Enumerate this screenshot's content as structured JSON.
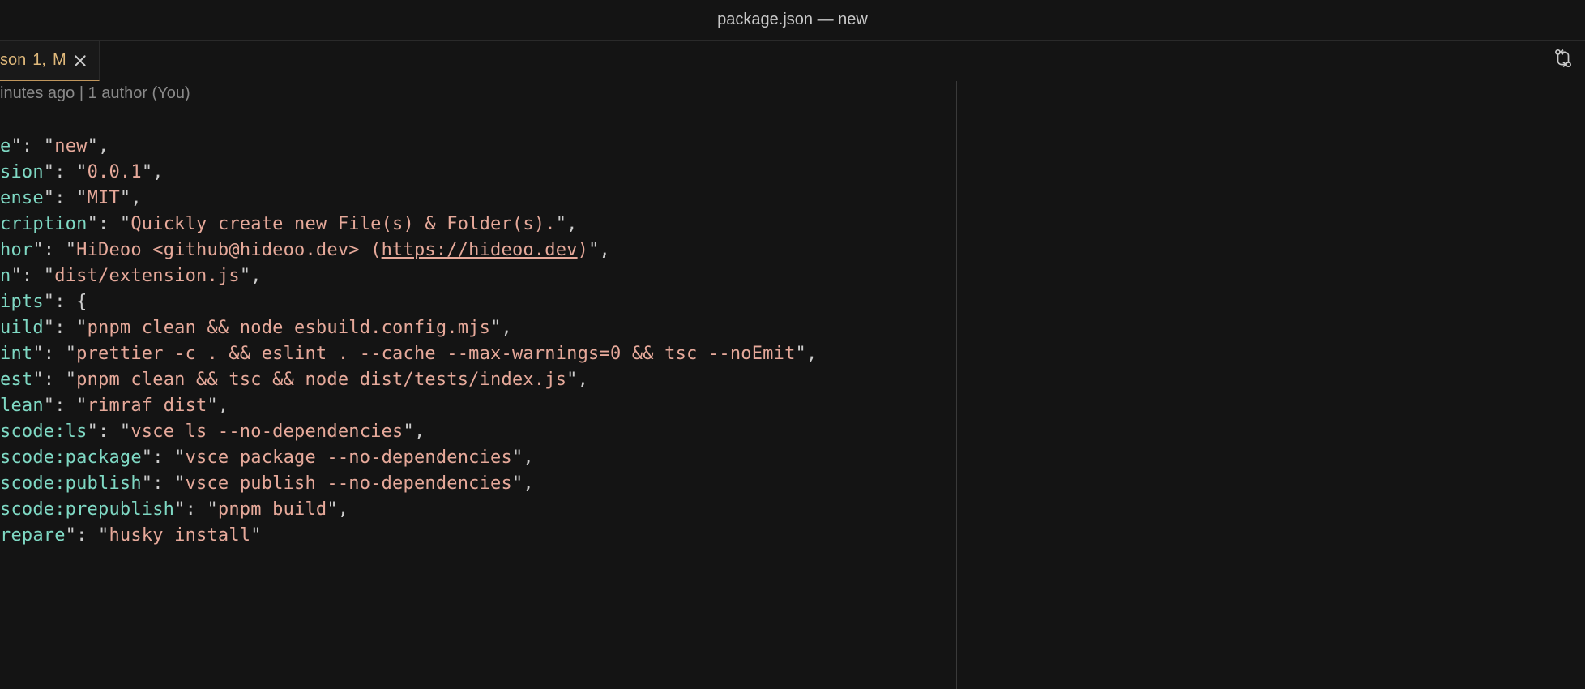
{
  "window": {
    "title": "package.json — new"
  },
  "tab": {
    "filename": "son",
    "problems": "1,",
    "status": "M"
  },
  "codelens": "inutes ago | 1 author (You)",
  "code": {
    "l1": {
      "keyFrag": "e",
      "val": "new"
    },
    "l2": {
      "keyFrag": "sion",
      "val": "0.0.1"
    },
    "l3": {
      "keyFrag": "ense",
      "val": "MIT"
    },
    "l4": {
      "keyFrag": "cription",
      "val": "Quickly create new File(s) & Folder(s)."
    },
    "l5": {
      "keyFrag": "hor",
      "valPre": "HiDeoo <github@hideoo.dev> (",
      "link": "https://hideoo.dev",
      "valPost": ")"
    },
    "l6": {
      "keyFrag": "n",
      "val": "dist/extension.js"
    },
    "l7": {
      "keyFrag": "ipts"
    },
    "l8": {
      "keyFrag": "uild",
      "val": "pnpm clean && node esbuild.config.mjs"
    },
    "l9": {
      "keyFrag": "int",
      "val": "prettier -c . && eslint . --cache --max-warnings=0 && tsc --noEmit"
    },
    "l10": {
      "keyFrag": "est",
      "val": "pnpm clean && tsc && node dist/tests/index.js"
    },
    "l11": {
      "keyFrag": "lean",
      "val": "rimraf dist"
    },
    "l12": {
      "keyFrag": "scode:ls",
      "val": "vsce ls --no-dependencies"
    },
    "l13": {
      "keyFrag": "scode:package",
      "val": "vsce package --no-dependencies"
    },
    "l14": {
      "keyFrag": "scode:publish",
      "val": "vsce publish --no-dependencies"
    },
    "l15": {
      "keyFrag": "scode:prepublish",
      "val": "pnpm build"
    },
    "l16": {
      "keyFrag": "repare",
      "val": "husky install"
    }
  }
}
